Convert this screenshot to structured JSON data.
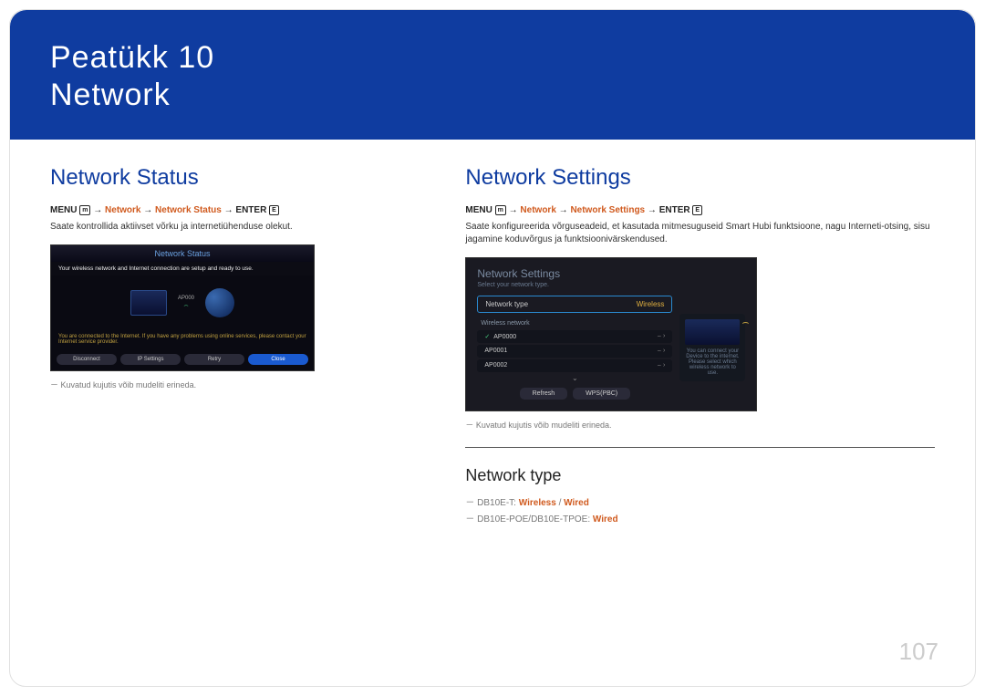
{
  "header": {
    "chapter_label": "Peatükk",
    "chapter_number": "10",
    "title": "Network"
  },
  "left": {
    "heading": "Network Status",
    "breadcrumb": {
      "pre": "MENU",
      "path1": "Network",
      "path2": "Network Status",
      "post": "ENTER"
    },
    "description": "Saate kontrollida aktiivset võrku ja internetiühenduse olekut.",
    "screenshot": {
      "title": "Network Status",
      "ready_msg": "Your wireless network and Internet connection are setup and ready to use.",
      "ap_label": "AP000",
      "footnote": "You are connected to the Internet. If you have any problems using online services, please contact your Internet service provider.",
      "buttons": {
        "disconnect": "Disconnect",
        "ip_settings": "IP Settings",
        "retry": "Retry",
        "close": "Close"
      }
    },
    "caption_note": "－ Kuvatud kujutis võib mudeliti erineda."
  },
  "right": {
    "heading": "Network Settings",
    "breadcrumb": {
      "pre": "MENU",
      "path1": "Network",
      "path2": "Network Settings",
      "post": "ENTER"
    },
    "description": "Saate konfigureerida võrguseadeid, et kasutada mitmesuguseid Smart Hubi funktsioone, nagu Interneti-otsing, sisu jagamine koduvõrgus ja funktsioonivärskendused.",
    "screenshot": {
      "title": "Network Settings",
      "subtitle": "Select your network type.",
      "network_type_label": "Network type",
      "network_type_value": "Wireless",
      "list_label": "Wireless network",
      "aps": [
        "AP0000",
        "AP0001",
        "AP0002"
      ],
      "side_note": "You can connect your Device to the internet. Please select which wireless network to use.",
      "buttons": {
        "refresh": "Refresh",
        "wps": "WPS(PBC)"
      }
    },
    "caption_note": "－ Kuvatud kujutis võib mudeliti erineda.",
    "network_type": {
      "heading": "Network type",
      "opt1_model": "－ DB10E-T: ",
      "opt1_a": "Wireless",
      "opt1_sep": " / ",
      "opt1_b": "Wired",
      "opt2_model": "－ DB10E-POE/DB10E-TPOE: ",
      "opt2_a": "Wired"
    }
  },
  "page_number": "107"
}
